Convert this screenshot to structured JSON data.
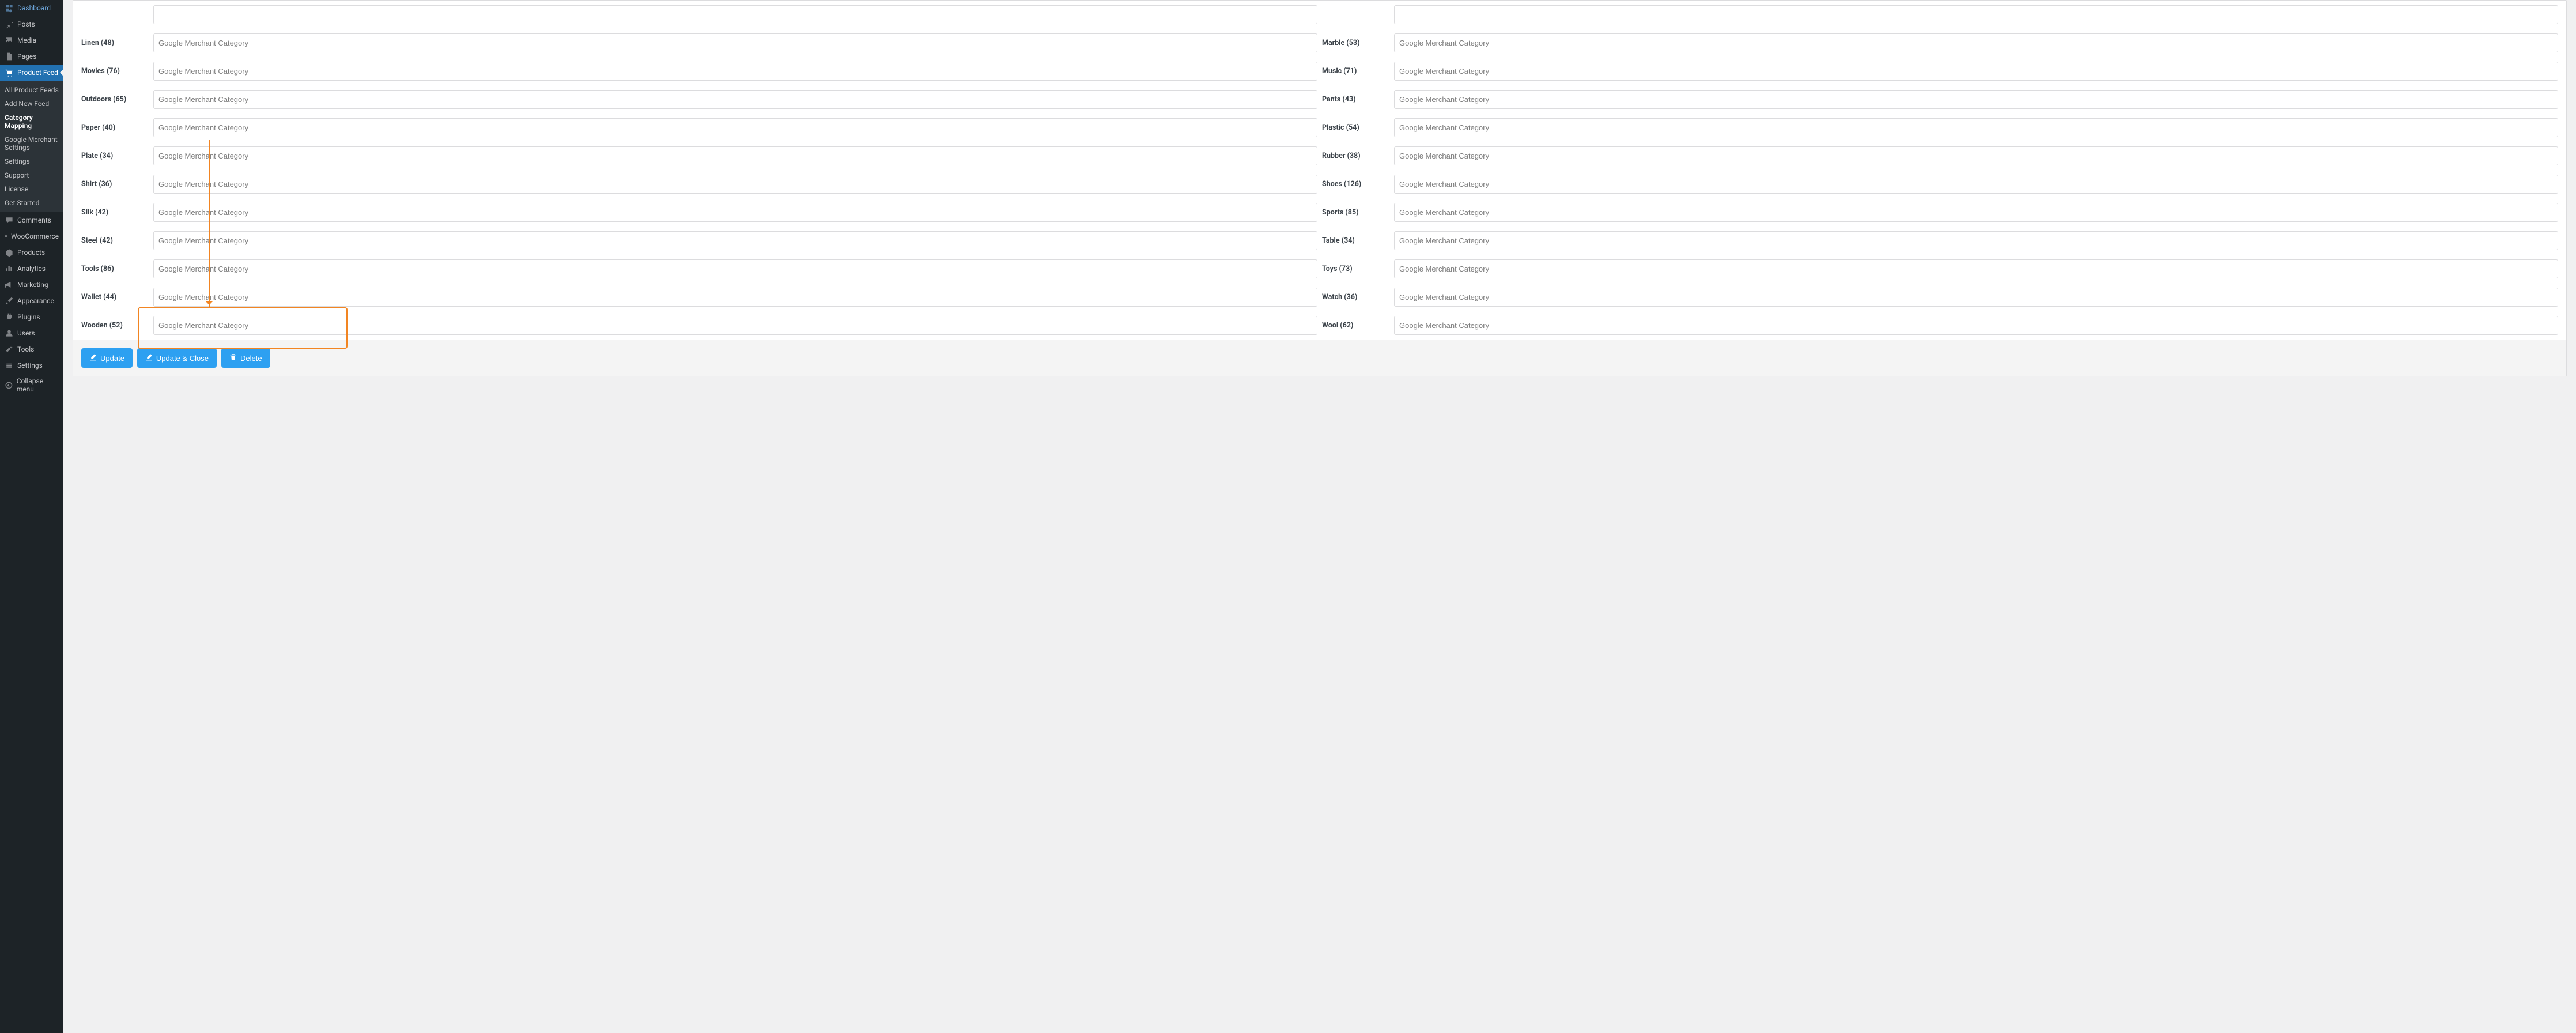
{
  "sidebar": {
    "items": [
      {
        "label": "Dashboard"
      },
      {
        "label": "Posts"
      },
      {
        "label": "Media"
      },
      {
        "label": "Pages"
      },
      {
        "label": "Product Feed"
      },
      {
        "label": "Comments"
      },
      {
        "label": "WooCommerce"
      },
      {
        "label": "Products"
      },
      {
        "label": "Analytics"
      },
      {
        "label": "Marketing"
      },
      {
        "label": "Appearance"
      },
      {
        "label": "Plugins"
      },
      {
        "label": "Users"
      },
      {
        "label": "Tools"
      },
      {
        "label": "Settings"
      },
      {
        "label": "Collapse menu"
      }
    ],
    "submenu": [
      "All Product Feeds",
      "Add New Feed",
      "Category Mapping",
      "Google Merchant Settings",
      "Settings",
      "Support",
      "License",
      "Get Started"
    ]
  },
  "placeholder": "Google Merchant Category",
  "categoriesLeft": [
    {
      "label": "Linen (48)"
    },
    {
      "label": "Movies (76)"
    },
    {
      "label": "Outdoors (65)"
    },
    {
      "label": "Paper (40)"
    },
    {
      "label": "Plate (34)"
    },
    {
      "label": "Shirt (36)"
    },
    {
      "label": "Silk (42)"
    },
    {
      "label": "Steel (42)"
    },
    {
      "label": "Tools (86)"
    },
    {
      "label": "Wallet (44)"
    },
    {
      "label": "Wooden (52)"
    }
  ],
  "categoriesRight": [
    {
      "label": "Marble (53)"
    },
    {
      "label": "Music (71)"
    },
    {
      "label": "Pants (43)"
    },
    {
      "label": "Plastic (54)"
    },
    {
      "label": "Rubber (38)"
    },
    {
      "label": "Shoes (126)"
    },
    {
      "label": "Sports (85)"
    },
    {
      "label": "Table (34)"
    },
    {
      "label": "Toys (73)"
    },
    {
      "label": "Watch (36)"
    },
    {
      "label": "Wool (62)"
    }
  ],
  "buttons": {
    "update": "Update",
    "updateClose": "Update & Close",
    "delete": "Delete"
  }
}
